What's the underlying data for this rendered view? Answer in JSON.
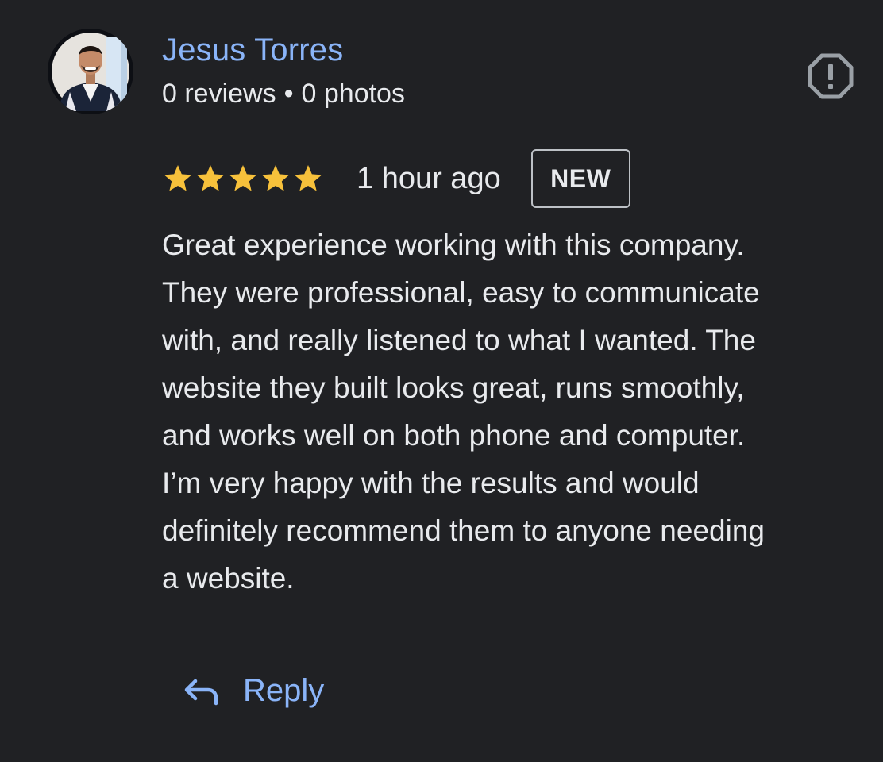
{
  "reviewer": {
    "name": "Jesus Torres",
    "reviews": "0 reviews",
    "separator": "•",
    "photos": "0 photos"
  },
  "review": {
    "stars": 5,
    "star_color": "#f7c13b",
    "time_ago": "1 hour ago",
    "badge": "NEW",
    "text_lines": [
      "Great experience working with this company.",
      "They were professional, easy to communicate",
      "with, and really listened to what I wanted. The",
      "website they built looks great, runs smoothly,",
      "and works well on both phone and computer.",
      "I’m very happy with the results and would",
      "definitely recommend them to anyone needing",
      "a website."
    ]
  },
  "actions": {
    "reply_label": "Reply",
    "reply_icon": "reply-arrow-icon",
    "report_icon": "report-octagon-icon"
  },
  "colors": {
    "background": "#202124",
    "link": "#8ab4f8",
    "text": "#e8eaed"
  }
}
